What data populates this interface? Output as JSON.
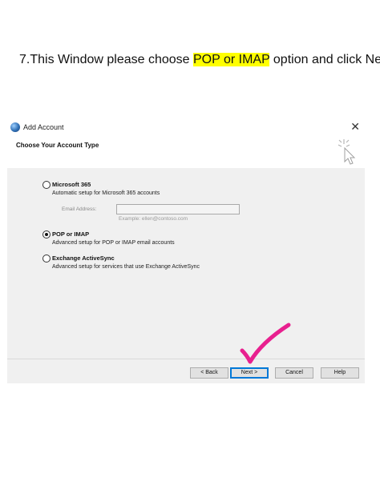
{
  "instruction": {
    "prefix": "7.This Window please choose ",
    "highlight": "POP or IMAP",
    "suffix": " option and click Next"
  },
  "dialog": {
    "title": "Add Account",
    "close_icon": "close-icon",
    "header_title": "Choose Your Account Type",
    "options": [
      {
        "label": "Microsoft 365",
        "description": "Automatic setup for Microsoft 365 accounts",
        "selected": false
      },
      {
        "label": "POP or IMAP",
        "description": "Advanced setup for POP or IMAP email accounts",
        "selected": true
      },
      {
        "label": "Exchange ActiveSync",
        "description": "Advanced setup for services that use Exchange ActiveSync",
        "selected": false
      }
    ],
    "email": {
      "label": "Email Address:",
      "value": "",
      "example": "Example: ellen@contoso.com"
    },
    "buttons": {
      "back": "< Back",
      "next": "Next >",
      "cancel": "Cancel",
      "help": "Help"
    }
  },
  "annotation": {
    "checkmark_color": "#e8208f"
  }
}
